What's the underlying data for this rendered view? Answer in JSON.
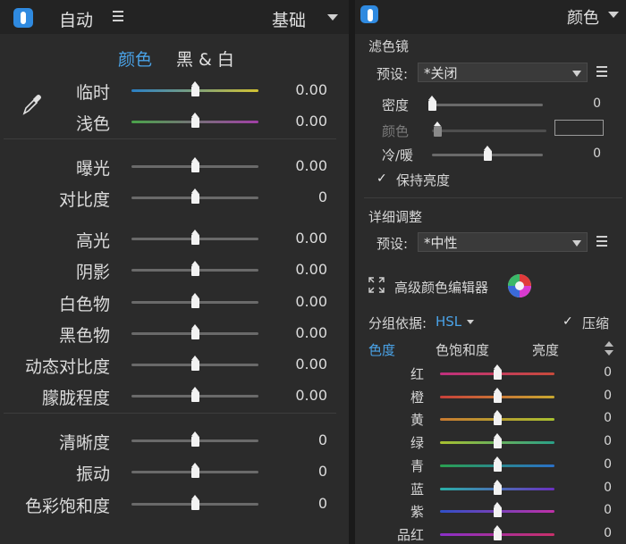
{
  "left": {
    "header": {
      "mode": "自动",
      "preset": "基础"
    },
    "tabs": [
      {
        "label": "颜色"
      },
      {
        "label": "黑 & 白"
      }
    ],
    "wb": [
      {
        "label": "临时",
        "value": "0.00",
        "thumb": 0.5,
        "gradient": [
          "#2a7fc5",
          "#d2c232"
        ]
      },
      {
        "label": "浅色",
        "value": "0.00",
        "thumb": 0.5,
        "gradient": [
          "#4aa34a",
          "#a13fa6"
        ]
      }
    ],
    "tone": [
      {
        "label": "曝光",
        "value": "0.00",
        "thumb": 0.5
      },
      {
        "label": "对比度",
        "value": "0",
        "thumb": 0.5
      }
    ],
    "detail": [
      {
        "label": "高光",
        "value": "0.00",
        "thumb": 0.5
      },
      {
        "label": "阴影",
        "value": "0.00",
        "thumb": 0.5
      },
      {
        "label": "白色物",
        "value": "0.00",
        "thumb": 0.5
      },
      {
        "label": "黑色物",
        "value": "0.00",
        "thumb": 0.5
      },
      {
        "label": "动态对比度",
        "value": "0.00",
        "thumb": 0.5
      },
      {
        "label": "朦胧程度",
        "value": "0.00",
        "thumb": 0.5
      }
    ],
    "presence": [
      {
        "label": "清晰度",
        "value": "0",
        "thumb": 0.5
      },
      {
        "label": "振动",
        "value": "0",
        "thumb": 0.5
      },
      {
        "label": "色彩饱和度",
        "value": "0",
        "thumb": 0.5
      }
    ]
  },
  "right": {
    "header": {
      "title": "颜色"
    },
    "filter": {
      "title": "滤色镜",
      "preset_label": "预设:",
      "preset_value": "*关闭",
      "sliders": [
        {
          "label": "密度",
          "value": "0",
          "thumb": 0.0,
          "dim": false
        },
        {
          "label": "颜色",
          "value": "",
          "thumb": 0.05,
          "dim": true
        },
        {
          "label": "冷/暖",
          "value": "0",
          "thumb": 0.5,
          "dim": false
        }
      ],
      "preserve_label": "保持亮度"
    },
    "detail": {
      "title": "详细调整",
      "preset_label": "预设:",
      "preset_value": "*中性",
      "advanced_label": "高级颜色编辑器",
      "group_label": "分组依据:",
      "group_value": "HSL",
      "compress_label": "压缩",
      "tabs": [
        "色度",
        "色饱和度",
        "亮度"
      ],
      "hues": [
        {
          "label": "红",
          "value": "0",
          "thumb": 0.5,
          "gradient": [
            "#c0307e",
            "#c84a3a"
          ]
        },
        {
          "label": "橙",
          "value": "0",
          "thumb": 0.5,
          "gradient": [
            "#c8403a",
            "#c8a830"
          ]
        },
        {
          "label": "黄",
          "value": "0",
          "thumb": 0.5,
          "gradient": [
            "#c87a30",
            "#a8c030"
          ]
        },
        {
          "label": "绿",
          "value": "0",
          "thumb": 0.5,
          "gradient": [
            "#a8c030",
            "#2aa088"
          ]
        },
        {
          "label": "青",
          "value": "0",
          "thumb": 0.5,
          "gradient": [
            "#2aa050",
            "#2a70c8"
          ]
        },
        {
          "label": "蓝",
          "value": "0",
          "thumb": 0.5,
          "gradient": [
            "#2ab0a8",
            "#6a30c0"
          ]
        },
        {
          "label": "紫",
          "value": "0",
          "thumb": 0.5,
          "gradient": [
            "#3050c8",
            "#c030a8"
          ]
        },
        {
          "label": "品红",
          "value": "0",
          "thumb": 0.5,
          "gradient": [
            "#8a30c8",
            "#c8306a"
          ]
        }
      ]
    }
  }
}
